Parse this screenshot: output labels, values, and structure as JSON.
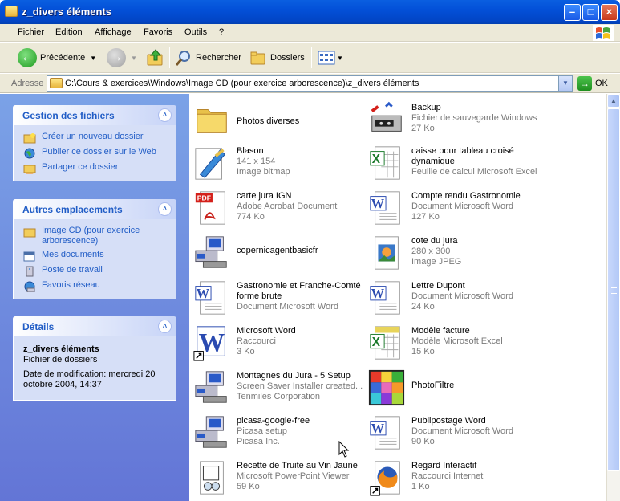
{
  "window": {
    "title": "z_divers éléments"
  },
  "menu": [
    "Fichier",
    "Edition",
    "Affichage",
    "Favoris",
    "Outils",
    "?"
  ],
  "toolbar": {
    "back": "Précédente",
    "search": "Rechercher",
    "folders": "Dossiers"
  },
  "address": {
    "label": "Adresse",
    "path": "C:\\Cours & exercices\\Windows\\Image CD (pour exercice arborescence)\\z_divers éléments",
    "go": "OK"
  },
  "sidebar": {
    "file_tasks": {
      "title": "Gestion des fichiers",
      "items": [
        "Créer un nouveau dossier",
        "Publier ce dossier sur le Web",
        "Partager ce dossier"
      ]
    },
    "other_places": {
      "title": "Autres emplacements",
      "items": [
        "Image CD (pour exercice arborescence)",
        "Mes documents",
        "Poste de travail",
        "Favoris réseau"
      ]
    },
    "details": {
      "title": "Détails",
      "name": "z_divers éléments",
      "type": "Fichier de dossiers",
      "modified": "Date de modification: mercredi 20 octobre 2004, 14:37"
    }
  },
  "files": {
    "left": [
      {
        "name": "Photos diverses",
        "l1": "",
        "l2": "",
        "icon": "folder-icon"
      },
      {
        "name": "Blason",
        "l1": "141 x 154",
        "l2": "Image bitmap",
        "icon": "bitmap-icon"
      },
      {
        "name": "carte jura IGN",
        "l1": "Adobe Acrobat Document",
        "l2": "774 Ko",
        "icon": "pdf-icon"
      },
      {
        "name": "copernicagentbasicfr",
        "l1": "",
        "l2": "",
        "icon": "installer-icon"
      },
      {
        "name": "Gastronomie et Franche-Comté forme brute",
        "l1": "Document Microsoft Word",
        "l2": "",
        "icon": "word-doc-icon"
      },
      {
        "name": "Microsoft Word",
        "l1": "Raccourci",
        "l2": "3 Ko",
        "icon": "word-shortcut-icon"
      },
      {
        "name": "Montagnes du Jura - 5 Setup",
        "l1": "Screen Saver Installer created...",
        "l2": "Tenmiles Corporation",
        "icon": "installer-icon"
      },
      {
        "name": "picasa-google-free",
        "l1": "Picasa setup",
        "l2": "Picasa Inc.",
        "icon": "installer-icon"
      },
      {
        "name": "Recette de Truite au Vin Jaune",
        "l1": "Microsoft PowerPoint Viewer",
        "l2": "59 Ko",
        "icon": "ppt-viewer-icon"
      }
    ],
    "right": [
      {
        "name": "Backup",
        "l1": "Fichier de sauvegarde Windows",
        "l2": "27 Ko",
        "icon": "backup-icon"
      },
      {
        "name": "caisse pour tableau croisé dynamique",
        "l1": "Feuille de calcul Microsoft Excel",
        "l2": "",
        "icon": "excel-icon"
      },
      {
        "name": "Compte rendu Gastronomie",
        "l1": "Document Microsoft Word",
        "l2": "127 Ko",
        "icon": "word-doc-icon"
      },
      {
        "name": "cote du jura",
        "l1": "280 x 300",
        "l2": "Image JPEG",
        "icon": "jpeg-icon"
      },
      {
        "name": "Lettre Dupont",
        "l1": "Document Microsoft Word",
        "l2": "24 Ko",
        "icon": "word-doc-icon"
      },
      {
        "name": "Modèle facture",
        "l1": "Modèle Microsoft Excel",
        "l2": "15 Ko",
        "icon": "excel-template-icon"
      },
      {
        "name": "PhotoFiltre",
        "l1": "",
        "l2": "",
        "icon": "photofiltre-icon"
      },
      {
        "name": "Publipostage Word",
        "l1": "Document Microsoft Word",
        "l2": "90 Ko",
        "icon": "word-doc-icon"
      },
      {
        "name": "Regard Interactif",
        "l1": "Raccourci Internet",
        "l2": "1 Ko",
        "icon": "firefox-shortcut-icon"
      }
    ]
  },
  "colors": {
    "title_bar": "#0350d8",
    "sidebar_bg": "#6e8ee0",
    "task_link": "#215dc6"
  }
}
